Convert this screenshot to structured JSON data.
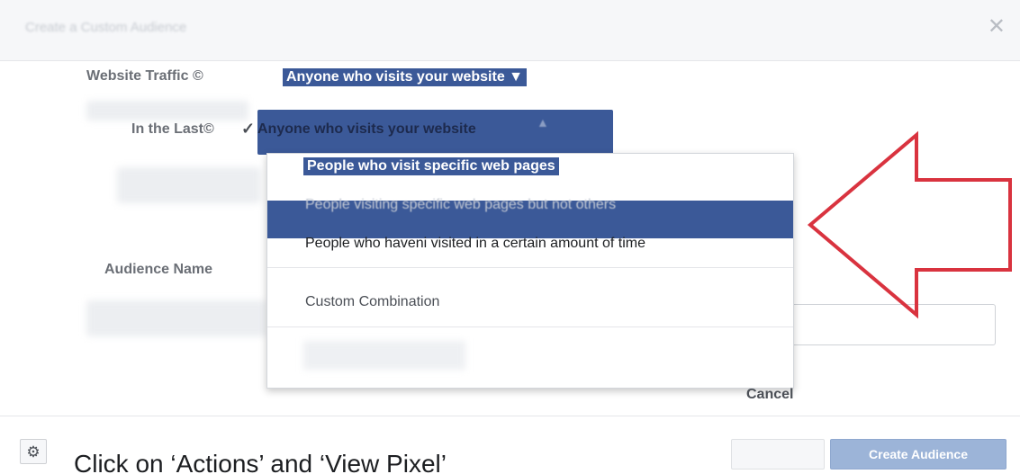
{
  "dialog": {
    "title": "Create a Custom Audience",
    "close_icon": "close-icon"
  },
  "form": {
    "traffic_label": "Website Traffic ©",
    "traffic_selected": "Anyone who visits your website ▼",
    "last_label": "In the Last©",
    "audience_name_label": "Audience Name"
  },
  "dropdown": {
    "check_glyph": "✓",
    "head": "Anyone who visits your website",
    "head_arrow": "▲",
    "options": [
      "People who visit specific web pages",
      "People visiting specific web pages but not others",
      "People who haveni visited in a certain amount of time",
      "Custom Combination"
    ]
  },
  "footer": {
    "cancel": "Cancel",
    "gear_glyph": "⚙",
    "caption": "Click on ‘Actions’ and ‘View Pixel’",
    "create_button": "Create Audience"
  },
  "colors": {
    "accent": "#3b5998",
    "arrow": "#d9333f"
  }
}
